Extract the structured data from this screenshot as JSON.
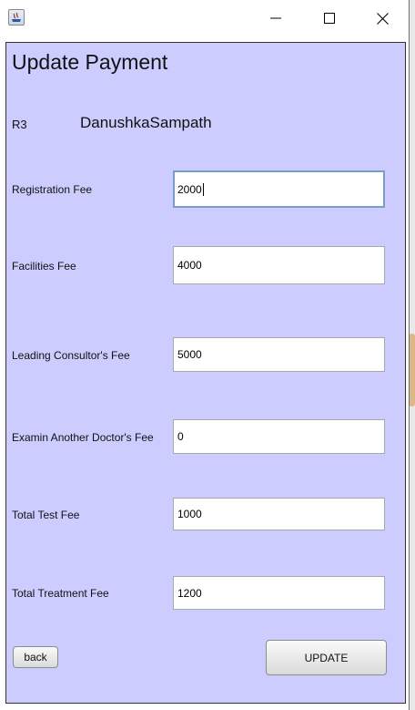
{
  "window": {
    "controls": {
      "minimize_icon": "minimize-icon",
      "maximize_icon": "maximize-icon",
      "close_icon": "close-icon"
    }
  },
  "form": {
    "heading": "Update Payment",
    "patient_id": "R3",
    "patient_name": "DanushkaSampath",
    "fields": {
      "registration": {
        "label": "Registration Fee",
        "value": "2000"
      },
      "facilities": {
        "label": "Facilities Fee",
        "value": "4000"
      },
      "consultant": {
        "label": "Leading Consultor's Fee",
        "value": "5000"
      },
      "another_doctor": {
        "label": "Examin Another Doctor's Fee",
        "value": "0"
      },
      "test": {
        "label": "Total Test Fee",
        "value": "1000"
      },
      "treatment": {
        "label": "Total Treatment Fee",
        "value": "1200"
      }
    },
    "buttons": {
      "back": "back",
      "update": "UPDATE"
    }
  },
  "colors": {
    "panel_background": "#ccccff",
    "focus_border": "#7a9cc8"
  }
}
